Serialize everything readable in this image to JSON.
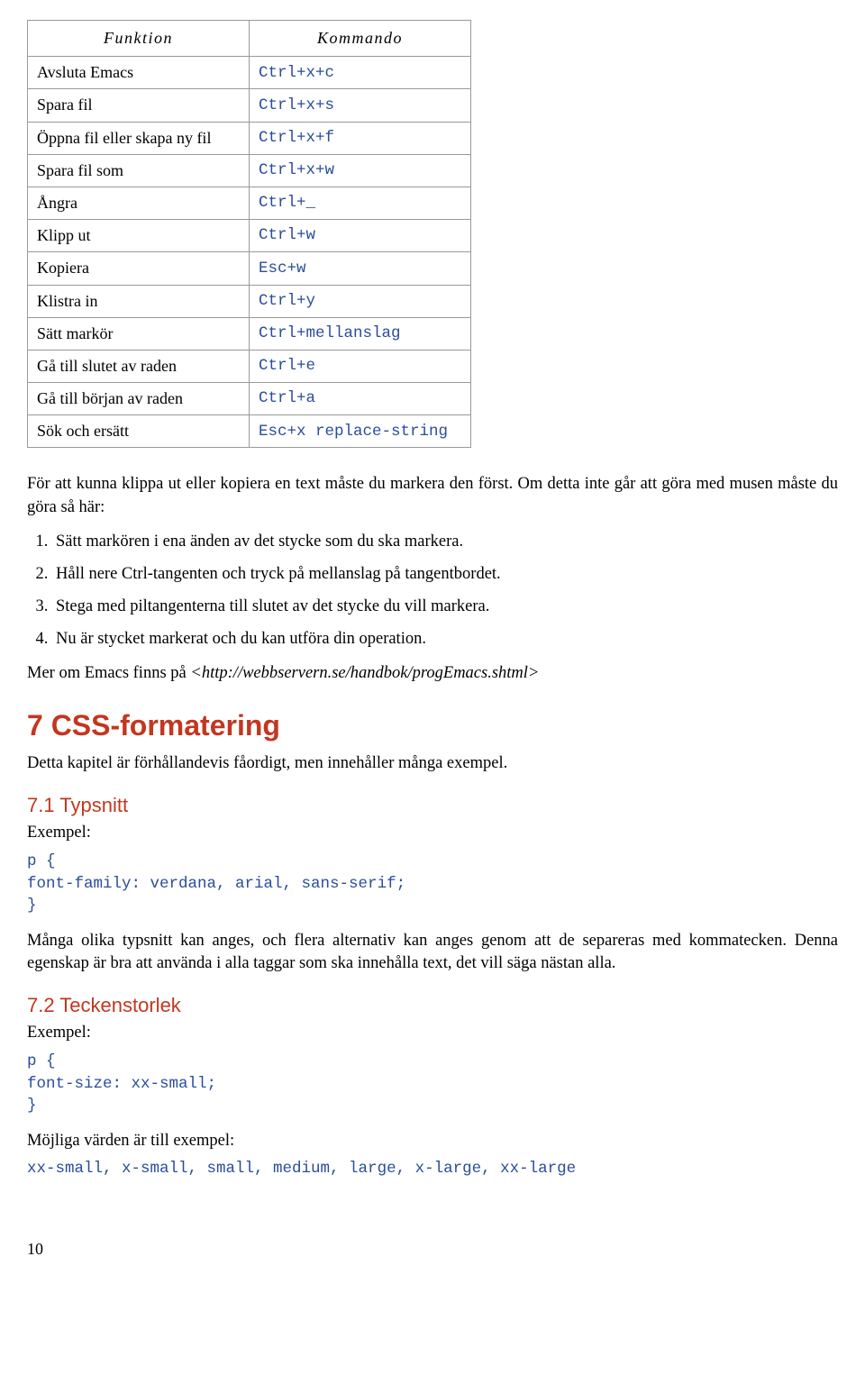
{
  "table": {
    "headers": {
      "func": "Funktion",
      "cmd": "Kommando"
    },
    "rows": [
      {
        "func": "Avsluta Emacs",
        "cmd": "Ctrl+x+c"
      },
      {
        "func": "Spara fil",
        "cmd": "Ctrl+x+s"
      },
      {
        "func": "Öppna fil eller skapa ny fil",
        "cmd": "Ctrl+x+f"
      },
      {
        "func": "Spara fil som",
        "cmd": "Ctrl+x+w"
      },
      {
        "func": "Ångra",
        "cmd": "Ctrl+_"
      },
      {
        "func": "Klipp ut",
        "cmd": "Ctrl+w"
      },
      {
        "func": "Kopiera",
        "cmd": "Esc+w"
      },
      {
        "func": "Klistra in",
        "cmd": "Ctrl+y"
      },
      {
        "func": "Sätt markör",
        "cmd": "Ctrl+mellanslag"
      },
      {
        "func": "Gå till slutet av raden",
        "cmd": "Ctrl+e"
      },
      {
        "func": "Gå till början av raden",
        "cmd": "Ctrl+a"
      },
      {
        "func": "Sök och ersätt",
        "cmd": "Esc+x replace-string"
      }
    ]
  },
  "para_intro": "För att kunna klippa ut eller kopiera en text måste du markera den först. Om detta inte går att göra med musen måste du göra så här:",
  "steps": [
    "Sätt markören i ena änden av det stycke som du ska markera.",
    "Håll nere Ctrl-tangenten och tryck på mellanslag på tangentbordet.",
    "Stega med piltangenterna till slutet av det stycke du vill markera.",
    "Nu är stycket markerat och du kan utföra din operation."
  ],
  "more_prefix": "Mer om Emacs finns på ",
  "more_link": "<http://webbservern.se/handbok/progEmacs.shtml>",
  "h1": "7 CSS-formatering",
  "para_css": "Detta kapitel är förhållandevis fåordigt, men innehåller många exempel.",
  "h2_1": "7.1 Typsnitt",
  "ex1_label": "Exempel:",
  "code1": "p {\nfont-family: verdana, arial, sans-serif;\n}",
  "para_fonts": "Många olika typsnitt kan anges, och flera alternativ kan anges genom att de separeras med kommatecken. Denna egenskap är bra att använda i alla taggar som ska innehålla text, det vill säga nästan alla.",
  "h2_2": "7.2 Teckenstorlek",
  "ex2_label": "Exempel:",
  "code2": "p {\nfont-size: xx-small;\n}",
  "para_sizes": "Möjliga värden är till exempel:",
  "code3": "xx-small, x-small, small, medium, large, x-large, xx-large",
  "page_number": "10"
}
